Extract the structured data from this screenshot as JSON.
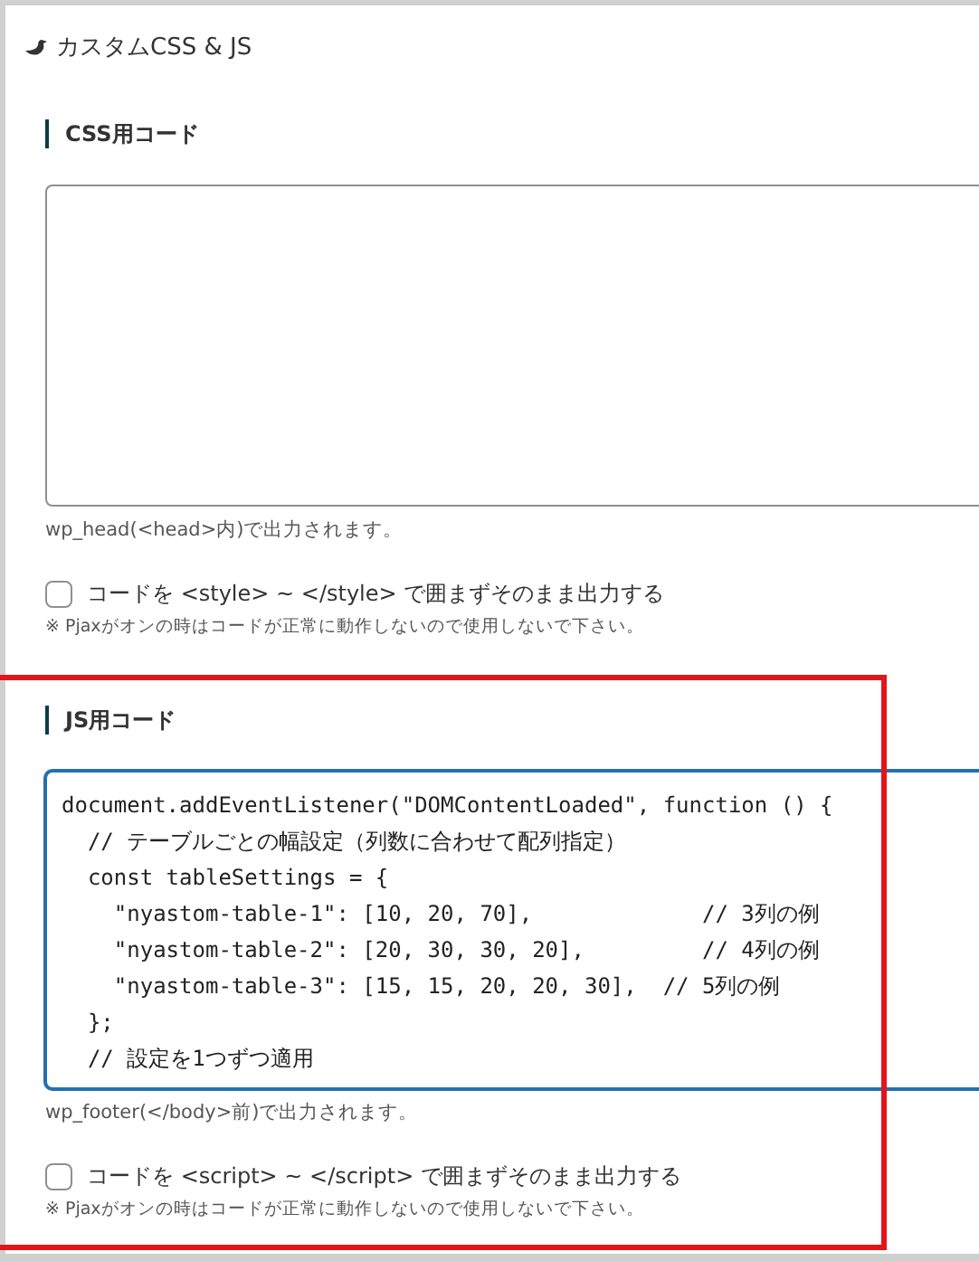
{
  "panel": {
    "title": "カスタムCSS & JS"
  },
  "sections": [
    {
      "heading": "CSS用コード",
      "focused": false,
      "help": "wp_head(<head>内)で出力されます。",
      "option": {
        "label": "コードを <style> ~ </style> で囲まずそのまま出力する",
        "checked": false
      },
      "note": "※ Pjaxがオンの時はコードが正常に動作しないので使用しないで下さい。",
      "highlighted": false
    },
    {
      "heading": "JS用コード",
      "code_lines": [
        "document.addEventListener(\"DOMContentLoaded\", function () {",
        "  // テーブルごとの幅設定（列数に合わせて配列指定）",
        "  const tableSettings = {",
        "    \"nyastom-table-1\": [10, 20, 70],             // 3列の例",
        "    \"nyastom-table-2\": [20, 30, 30, 20],         // 4列の例",
        "    \"nyastom-table-3\": [15, 15, 20, 20, 30],  // 5列の例",
        "  };",
        "  // 設定を1つずつ適用"
      ],
      "focused": true,
      "help": "wp_footer(</body>前)で出力されます。",
      "option": {
        "label": "コードを <script> ~ </script> で囲まずそのまま出力する",
        "checked": false
      },
      "note": "※ Pjaxがオンの時はコードが正常に動作しないので使用しないで下さい。",
      "highlighted": true
    }
  ]
}
